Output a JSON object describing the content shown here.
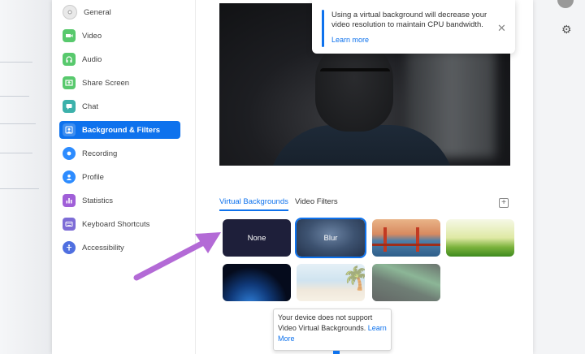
{
  "sidebar": {
    "items": [
      {
        "label": "General",
        "icon": "gear-icon",
        "color": "#e4e4e4"
      },
      {
        "label": "Video",
        "icon": "video-camera-icon",
        "color": "#58c96d"
      },
      {
        "label": "Audio",
        "icon": "headphones-icon",
        "color": "#58c96d"
      },
      {
        "label": "Share Screen",
        "icon": "share-screen-icon",
        "color": "#58c96d"
      },
      {
        "label": "Chat",
        "icon": "chat-bubble-icon",
        "color": "#3cb1ab"
      },
      {
        "label": "Background & Filters",
        "icon": "person-background-icon",
        "color": "#0e72ed",
        "active": true
      },
      {
        "label": "Recording",
        "icon": "record-icon",
        "color": "#2d8cff"
      },
      {
        "label": "Profile",
        "icon": "profile-icon",
        "color": "#2d8cff"
      },
      {
        "label": "Statistics",
        "icon": "statistics-icon",
        "color": "#a05fd8"
      },
      {
        "label": "Keyboard Shortcuts",
        "icon": "keyboard-icon",
        "color": "#7d6cd6"
      },
      {
        "label": "Accessibility",
        "icon": "accessibility-icon",
        "color": "#4f6fe0"
      }
    ]
  },
  "notice": {
    "message": "Using a virtual background will decrease your video resolution to maintain CPU bandwidth.",
    "learn_more": "Learn more"
  },
  "tabs": {
    "virtual_backgrounds": "Virtual Backgrounds",
    "video_filters": "Video Filters"
  },
  "backgrounds": {
    "none_label": "None",
    "blur_label": "Blur",
    "selected": "Blur"
  },
  "tooltip": {
    "text": "Your device does not support Video Virtual Backgrounds.",
    "link_part1": "Learn",
    "link_part2": "More"
  },
  "colors": {
    "accent": "#0e72ed",
    "arrow": "#b36ad6"
  }
}
